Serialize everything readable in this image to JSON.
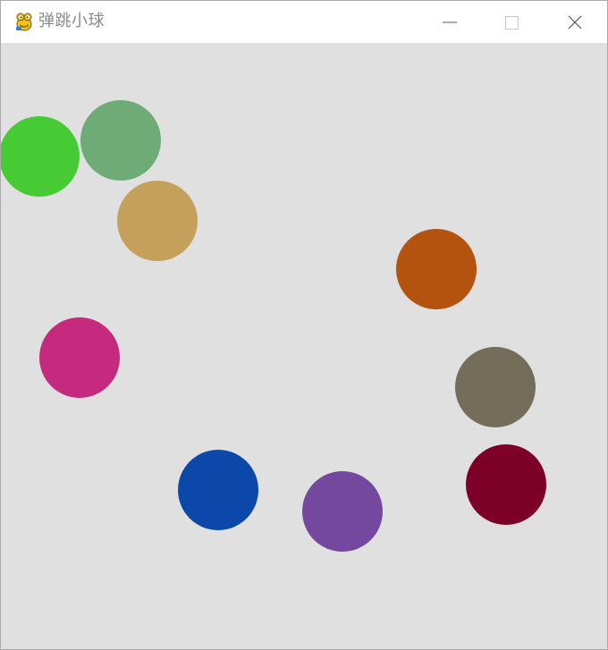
{
  "window": {
    "title": "弹跳小球",
    "app_icon": "pygame-snake-icon",
    "controls": {
      "minimize_icon": "minimize-icon",
      "maximize_icon": "maximize-icon",
      "close_icon": "close-icon"
    }
  },
  "canvas": {
    "background": "#e0e0e0",
    "balls": [
      {
        "name": "ball-green",
        "color": "#46cb35"
      },
      {
        "name": "ball-sage-green",
        "color": "#6fab76"
      },
      {
        "name": "ball-tan",
        "color": "#c5a05a"
      },
      {
        "name": "ball-orange",
        "color": "#b4530f"
      },
      {
        "name": "ball-magenta",
        "color": "#c52a7e"
      },
      {
        "name": "ball-grey-olive",
        "color": "#736d5a"
      },
      {
        "name": "ball-blue",
        "color": "#0b48aa"
      },
      {
        "name": "ball-purple",
        "color": "#74489e"
      },
      {
        "name": "ball-crimson",
        "color": "#7c0028"
      }
    ]
  }
}
